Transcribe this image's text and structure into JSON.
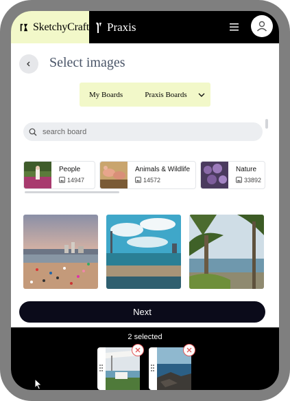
{
  "header": {
    "brand_left": "SketchyCraft",
    "brand_right": "Praxis",
    "menu_icon": "hamburger-icon",
    "account_icon": "user-icon"
  },
  "page": {
    "title": "Select images",
    "back_icon": "chevron-left-icon"
  },
  "boards": {
    "tabs": [
      {
        "label": "My Boards"
      },
      {
        "label": "Praxis Boards"
      }
    ],
    "dropdown_icon": "chevron-down-icon"
  },
  "search": {
    "placeholder": "search board",
    "icon": "search-icon"
  },
  "categories": [
    {
      "name": "People",
      "count": "14947"
    },
    {
      "name": "Animals & Wildlife",
      "count": "14572"
    },
    {
      "name": "Nature",
      "count": "33892"
    }
  ],
  "next_label": "Next",
  "tray": {
    "selected_text": "2 selected"
  },
  "colors": {
    "accent_lime": "#f2f8c9",
    "dark": "#0b0b1a",
    "remove_red": "#e05757"
  }
}
